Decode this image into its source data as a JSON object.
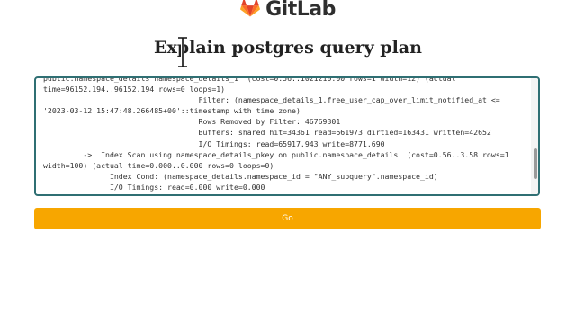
{
  "brand": {
    "name": "GitLab",
    "logo_icon": "gitlab-tanuki-icon",
    "logo_colors": [
      "#e24329",
      "#fc6d26",
      "#fca326"
    ]
  },
  "page": {
    "title": "Explain postgres query plan"
  },
  "query_input": {
    "value": "public.namespace_details namespace_details_1  (cost=0.56..1021210.00 rows=1 width=12) (actual\ntime=96152.194..96152.194 rows=0 loops=1)\n                                   Filter: (namespace_details_1.free_user_cap_over_limit_notified_at <=\n'2023-03-12 15:47:48.266485+00'::timestamp with time zone)\n                                   Rows Removed by Filter: 46769301\n                                   Buffers: shared hit=34361 read=661973 dirtied=163431 written=42652\n                                   I/O Timings: read=65917.943 write=8771.690\n         ->  Index Scan using namespace_details_pkey on public.namespace_details  (cost=0.56..3.58 rows=1\nwidth=100) (actual time=0.000..0.000 rows=0 loops=0)\n               Index Cond: (namespace_details.namespace_id = \"ANY_subquery\".namespace_id)\n               I/O Timings: read=0.000 write=0.000",
    "scroll_position": 0.9
  },
  "actions": {
    "go_label": "Go"
  },
  "colors": {
    "accent": "#f7a600",
    "input_border": "#2f6f73"
  }
}
